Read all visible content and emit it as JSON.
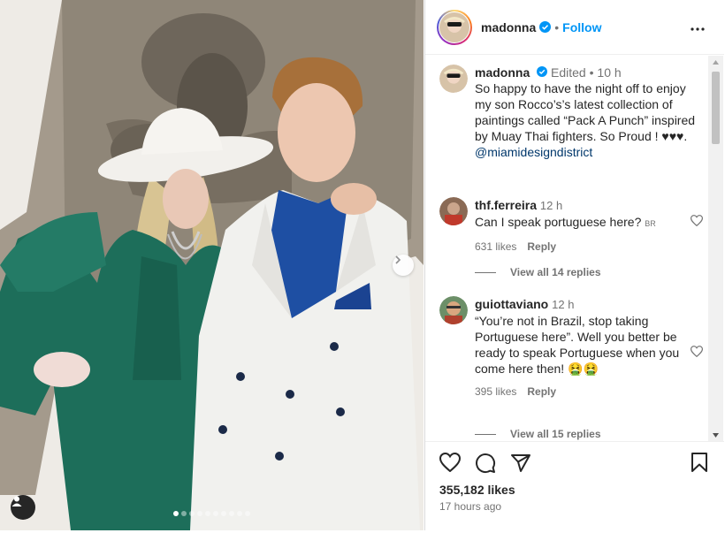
{
  "post": {
    "carousel": {
      "total": 10,
      "active": 0
    }
  },
  "header": {
    "username": "madonna",
    "separator": "•",
    "follow_label": "Follow"
  },
  "caption": {
    "username": "madonna",
    "edited": "Edited",
    "dot": "•",
    "age": "10 h",
    "text": "So happy to have the night off to enjoy my son Rocco’s’s latest collection of paintings called “Pack A Punch” inspired by Muay Thai fighters. So Proud ! ♥♥♥.",
    "mention": "@miamidesigndistrict"
  },
  "comments": [
    {
      "username": "thf.ferreira",
      "age": "12 h",
      "text": "Can I speak portuguese here?",
      "flag": "BR",
      "likes": "631 likes",
      "reply_label": "Reply",
      "view_replies": "View all 14 replies"
    },
    {
      "username": "guiottaviano",
      "age": "12 h",
      "text": "“You’re not in Brazil, stop taking Portuguese here”. Well you better be ready to speak Portuguese when you come here then!",
      "emoji": "🤮🤮",
      "emoji_line": "🤮",
      "likes": "395 likes",
      "reply_label": "Reply",
      "view_replies": "View all 15 replies"
    }
  ],
  "footer": {
    "likes": "355,182 likes",
    "timestamp": "17 hours ago"
  },
  "colors": {
    "accent": "#0095f6",
    "verified": "#0095f6",
    "text": "#262626",
    "muted": "#737373",
    "suit_green": "#1d6e5a",
    "shirt_blue": "#1e4fa3"
  },
  "icons": [
    "chevron-right-icon",
    "user-tag-icon",
    "verified-icon",
    "more-icon",
    "heart-icon",
    "comment-icon",
    "share-icon",
    "bookmark-icon"
  ]
}
